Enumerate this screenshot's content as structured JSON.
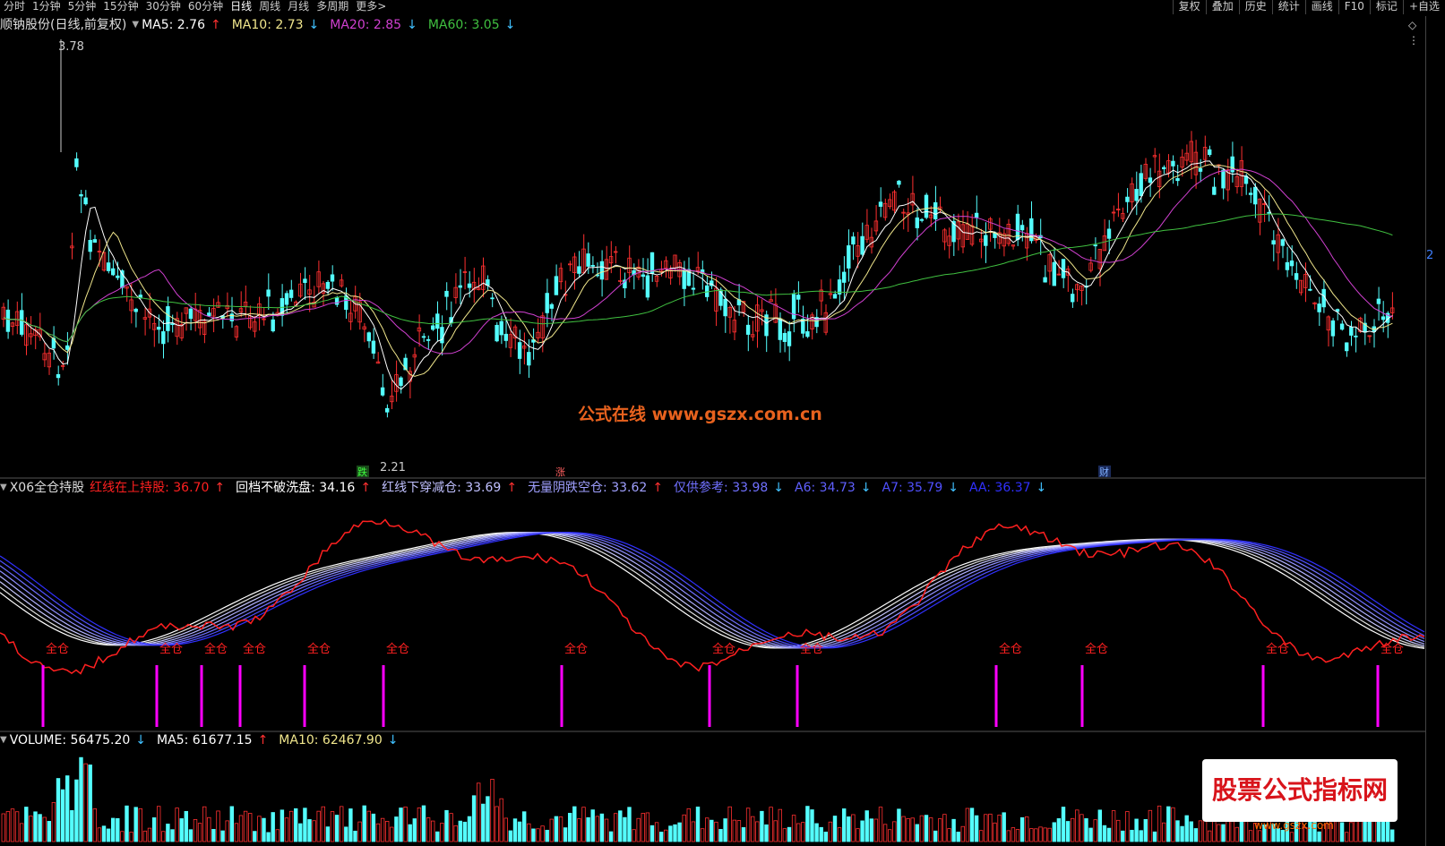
{
  "toolbar": {
    "periods": [
      "分时",
      "1分钟",
      "5分钟",
      "15分钟",
      "30分钟",
      "60分钟",
      "日线",
      "周线",
      "月线",
      "多周期",
      "更多>"
    ],
    "active_period": "日线",
    "tools": [
      "复权",
      "叠加",
      "历史",
      "统计",
      "画线",
      "F10",
      "标记",
      "+自选"
    ]
  },
  "main_panel": {
    "title": "顺钠股份(日线,前复权)",
    "ma5": {
      "label": "MA5: 2.76",
      "arrow": "↑",
      "color": "#ffffff"
    },
    "ma10": {
      "label": "MA10: 2.73",
      "arrow": "↓",
      "color": "#f0e68c"
    },
    "ma20": {
      "label": "MA20: 2.85",
      "arrow": "↓",
      "color": "#d040d0"
    },
    "ma60": {
      "label": "MA60: 3.05",
      "arrow": "↓",
      "color": "#40c040"
    },
    "high_label": "3.78",
    "low_label": "2.21",
    "marker_die": "跌",
    "marker_zhang": "涨",
    "marker_cai": "财",
    "right_num": "2"
  },
  "indicator_panel": {
    "name": "X06全仓持股",
    "l1": {
      "label": "红线在上持股: 36.70",
      "arrow": "↑",
      "color": "#ff2020"
    },
    "l2": {
      "label": "回档不破洗盘: 34.16",
      "arrow": "↑",
      "color": "#ffffff"
    },
    "l3": {
      "label": "红线下穿减仓: 33.69",
      "arrow": "↑",
      "color": "#c0c0ff"
    },
    "l4": {
      "label": "无量阴跌空仓: 33.62",
      "arrow": "↑",
      "color": "#a0a0ff"
    },
    "l5": {
      "label": "仅供参考: 33.98",
      "arrow": "↓",
      "color": "#7070ff"
    },
    "l6": {
      "label": "A6: 34.73",
      "arrow": "↓",
      "color": "#6060ff"
    },
    "l7": {
      "label": "A7: 35.79",
      "arrow": "↓",
      "color": "#5050ff"
    },
    "l8": {
      "label": "AA: 36.37",
      "arrow": "↓",
      "color": "#3030ff"
    },
    "signal_text": "全仓"
  },
  "volume_panel": {
    "volume": {
      "label": "VOLUME: 56475.20",
      "arrow": "↓",
      "color": "#ffffff"
    },
    "ma5": {
      "label": "MA5: 61677.15",
      "arrow": "↑",
      "color": "#ffffff"
    },
    "ma10": {
      "label": "MA10: 62467.90",
      "arrow": "↓",
      "color": "#f0e68c"
    }
  },
  "watermark": {
    "text": "公式在线  www.gszx.com.cn"
  },
  "logo": {
    "text": "股票公式指标网",
    "url": "www.gszx.com"
  },
  "colors": {
    "up": "#ff3030",
    "down": "#54ffff",
    "signal": "#ff00ff"
  }
}
